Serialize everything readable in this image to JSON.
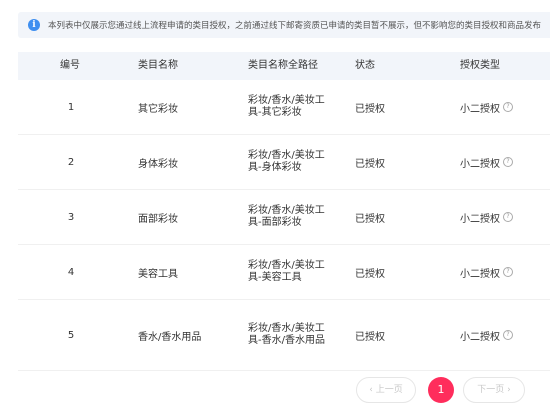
{
  "notice": {
    "icon": "info-icon",
    "text": "本列表中仅展示您通过线上流程申请的类目授权，之前通过线下邮寄资质已申请的类目暂不展示，但不影响您的类目授权和商品发布"
  },
  "table": {
    "headers": {
      "no": "编号",
      "name": "类目名称",
      "path": "类目名称全路径",
      "status": "状态",
      "type": "授权类型"
    },
    "rows": [
      {
        "no": "1",
        "name": "其它彩妆",
        "path": "彩妆/香水/美妆工具-其它彩妆",
        "status": "已授权",
        "type": "小二授权"
      },
      {
        "no": "2",
        "name": "身体彩妆",
        "path": "彩妆/香水/美妆工具-身体彩妆",
        "status": "已授权",
        "type": "小二授权"
      },
      {
        "no": "3",
        "name": "面部彩妆",
        "path": "彩妆/香水/美妆工具-面部彩妆",
        "status": "已授权",
        "type": "小二授权"
      },
      {
        "no": "4",
        "name": "美容工具",
        "path": "彩妆/香水/美妆工具-美容工具",
        "status": "已授权",
        "type": "小二授权"
      },
      {
        "no": "5",
        "name": "香水/香水用品",
        "path": "彩妆/香水/美妆工具-香水/香水用品",
        "status": "已授权",
        "type": "小二授权"
      }
    ]
  },
  "pagination": {
    "prev_label": "‹ 上一页",
    "current_page": "1",
    "next_label": "下一页 ›"
  },
  "colors": {
    "accent": "#ff2d5c",
    "info": "#3f8ff0",
    "header_bg": "#f2f5fa"
  }
}
